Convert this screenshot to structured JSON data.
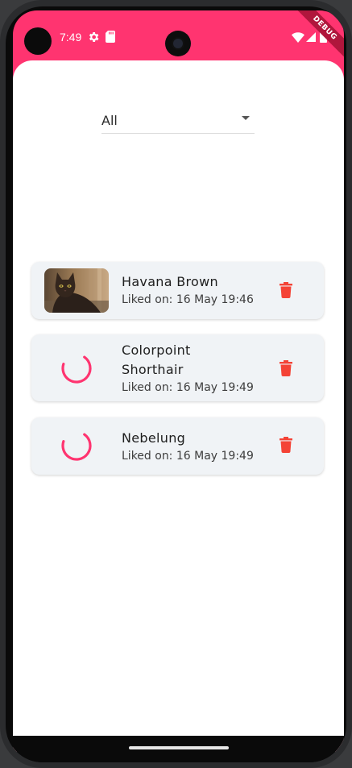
{
  "status_bar": {
    "time": "7:49",
    "icons": [
      "gear-icon",
      "sd-card-icon",
      "wifi-icon",
      "signal-icon",
      "battery-icon"
    ]
  },
  "debug_banner": "DEBUG",
  "filter": {
    "selected": "All"
  },
  "favourites": [
    {
      "name": "Havana Brown",
      "liked_on": "Liked on: 16 May 19:46",
      "image": "cat-photo",
      "loading": false
    },
    {
      "name_line1": "Colorpoint",
      "name_line2": "Shorthair",
      "liked_on": "Liked on: 16 May 19:49",
      "loading": true
    },
    {
      "name": "Nebelung",
      "liked_on": "Liked on: 16 May 19:49",
      "loading": true
    }
  ],
  "colors": {
    "accent": "#ff3470",
    "delete": "#f44336",
    "card_bg": "#f0f3f6"
  }
}
